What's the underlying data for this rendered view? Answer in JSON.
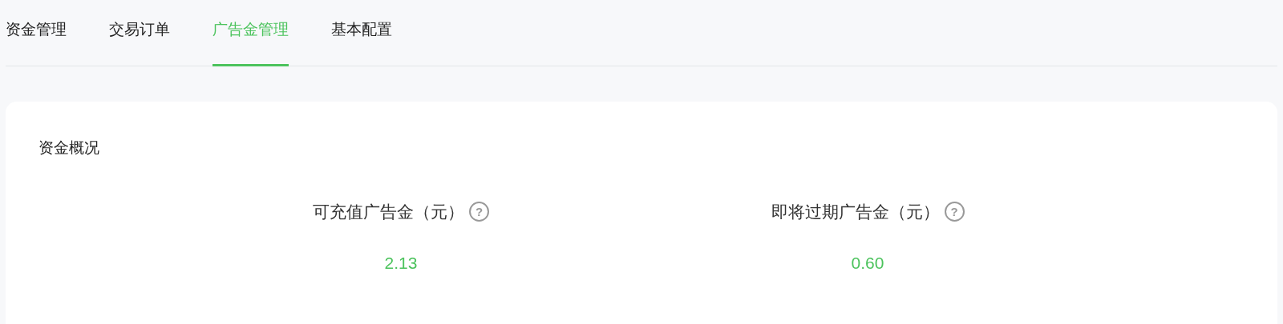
{
  "tabs": [
    {
      "label": "资金管理",
      "selected": false
    },
    {
      "label": "交易订单",
      "selected": false
    },
    {
      "label": "广告金管理",
      "selected": true
    },
    {
      "label": "基本配置",
      "selected": false
    }
  ],
  "card": {
    "title": "资金概况",
    "stats": [
      {
        "label": "可充值广告金（元）",
        "help_icon": "?",
        "value": "2.13"
      },
      {
        "label": "即将过期广告金（元）",
        "help_icon": "?",
        "value": "0.60"
      }
    ]
  }
}
